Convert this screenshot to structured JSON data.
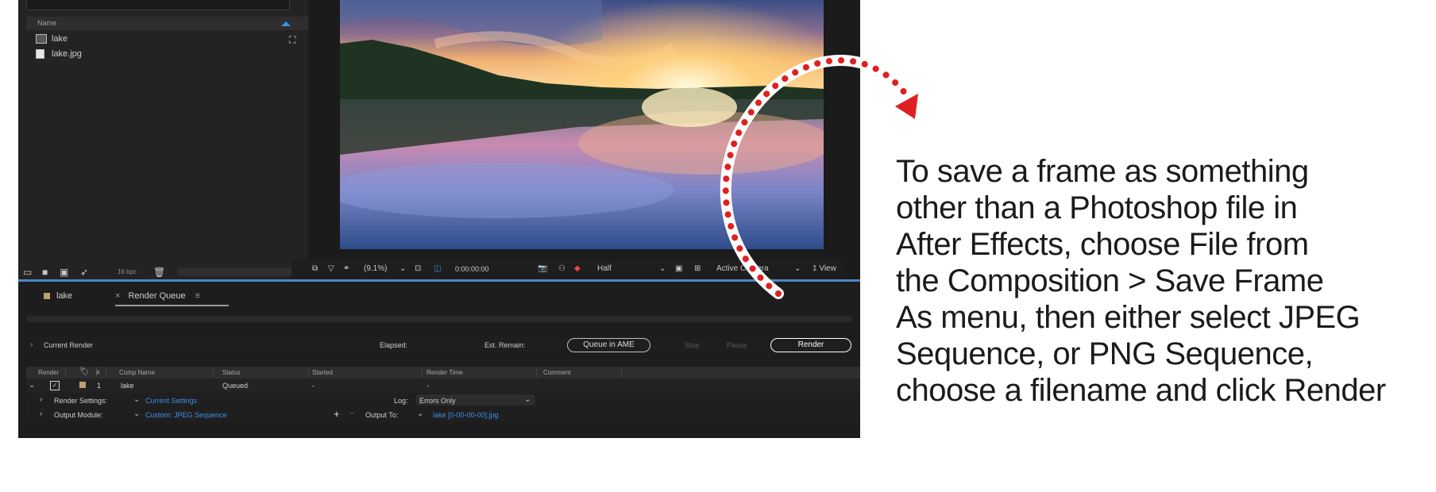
{
  "project_panel": {
    "column_name": "Name",
    "items": [
      {
        "icon": "composition-icon",
        "label": "lake"
      },
      {
        "icon": "image-file-icon",
        "label": "lake.jpg"
      }
    ],
    "footer": {
      "bpc": "16 bpc"
    }
  },
  "viewer": {
    "magnification": "(9.1%)",
    "timecode": "0:00:00:00",
    "resolution": "Half",
    "camera": "Active Camera",
    "view": "1 View"
  },
  "tabs": [
    {
      "label": "lake"
    },
    {
      "label": "Render Queue"
    }
  ],
  "render_queue": {
    "current_render": "Current Render",
    "elapsed": "Elapsed:",
    "est_remain": "Est. Remain:",
    "queue_in_ame": "Queue in AME",
    "stop": "Stop",
    "pause": "Pause",
    "render": "Render",
    "columns": [
      "Render",
      "#",
      "Comp Name",
      "Status",
      "Started",
      "Render Time",
      "Comment"
    ],
    "item": {
      "number": "1",
      "comp_name": "lake",
      "status": "Queued",
      "started": "-",
      "render_time": "-"
    },
    "render_settings_label": "Render Settings:",
    "render_settings_value": "Current Settings",
    "log_label": "Log:",
    "log_value": "Errors Only",
    "output_module_label": "Output Module:",
    "output_module_value": "Custom: JPEG Sequence",
    "output_to_label": "Output To:",
    "output_to_value": "lake [0-00-00-00].jpg"
  },
  "caption": {
    "lines": [
      "To save a frame as something",
      "other than a Photoshop file in",
      "After Effects, choose File from",
      "the Composition > Save Frame",
      "As menu, then either select JPEG",
      "Sequence, or PNG Sequence,",
      "choose a filename and click Render"
    ]
  },
  "colors": {
    "accent": "#3d8ff0",
    "arrow": "#e02020",
    "panel_bg": "#232323",
    "app_bg": "#1d1d1d"
  }
}
